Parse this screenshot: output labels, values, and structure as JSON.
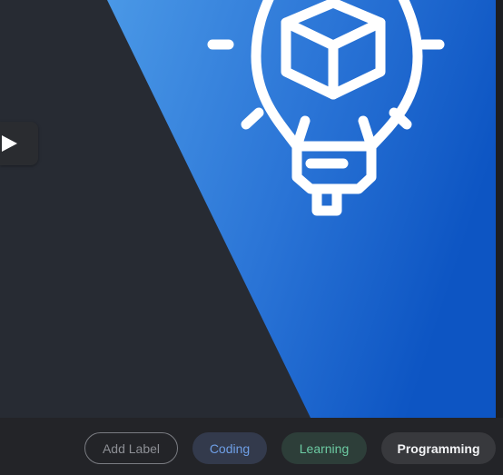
{
  "video": {
    "play_icon": "play-icon",
    "art_icon": "lightbulb-cube-icon",
    "colors": {
      "dark_panel": "#272b33",
      "gradient_start": "#4a98e6",
      "gradient_end": "#0d55c3"
    }
  },
  "labels": {
    "add_label": "Add Label",
    "items": [
      {
        "text": "Coding",
        "color": "#6f9fe6"
      },
      {
        "text": "Learning",
        "color": "#6ccaa2"
      },
      {
        "text": "Programming",
        "color": "#f2f3f5"
      }
    ]
  }
}
